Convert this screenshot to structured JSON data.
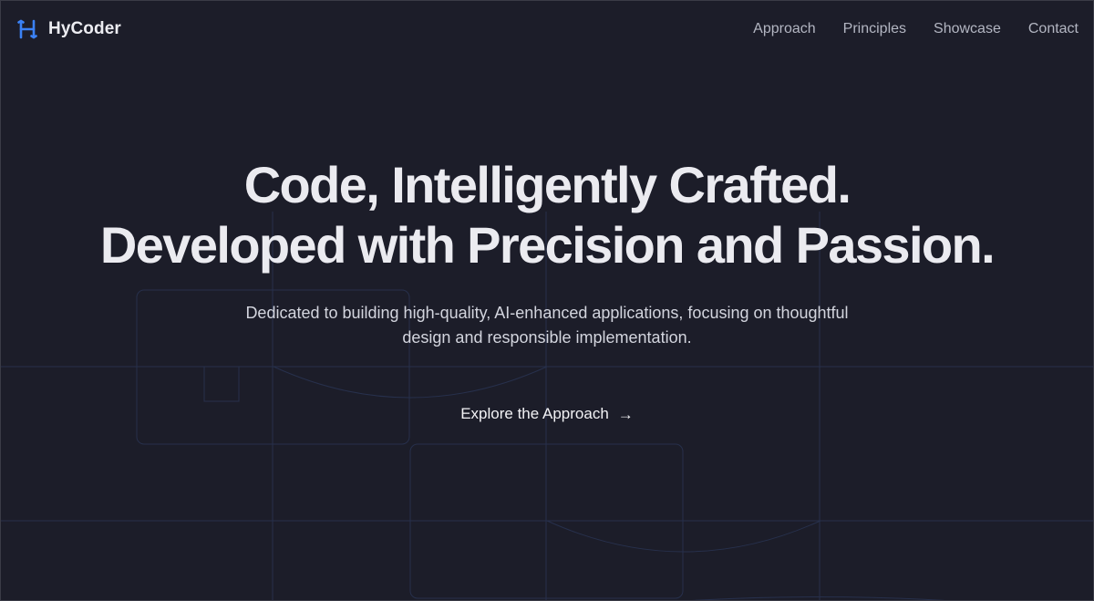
{
  "brand": {
    "name": "HyCoder",
    "logo_icon": "h-logo-icon",
    "accent": "#3b82f6"
  },
  "nav": {
    "items": [
      {
        "label": "Approach"
      },
      {
        "label": "Principles"
      },
      {
        "label": "Showcase"
      },
      {
        "label": "Contact"
      }
    ]
  },
  "hero": {
    "headline_line1": "Code, Intelligently Crafted.",
    "headline_line2": "Developed with Precision and Passion.",
    "subtitle": "Dedicated to building high-quality, AI-enhanced applications, focusing on thoughtful design and responsible implementation.",
    "cta_label": "Explore the Approach",
    "cta_icon": "arrow-right-icon"
  },
  "colors": {
    "background": "#1c1d29",
    "text": "#ebebf0",
    "muted": "#b3b6c2",
    "grid": "#27304c"
  }
}
